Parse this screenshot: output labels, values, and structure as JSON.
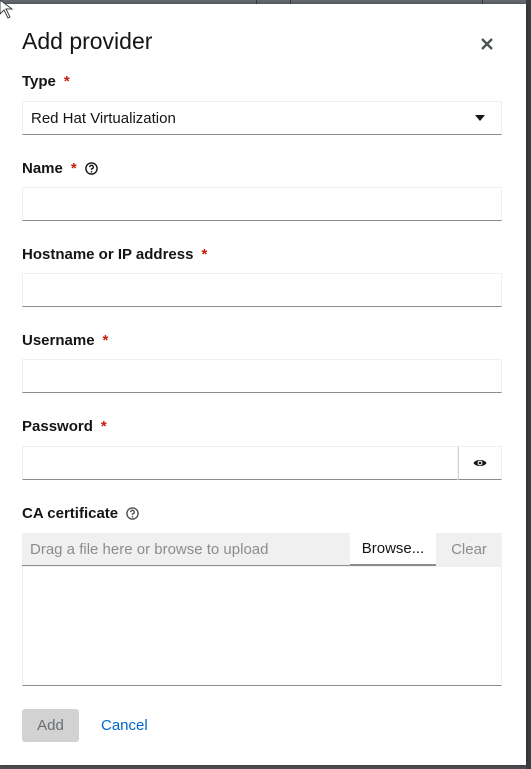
{
  "modal": {
    "title": "Add provider",
    "close_icon": "close-icon"
  },
  "form": {
    "required_marker": "*",
    "type": {
      "label": "Type",
      "selected": "Red Hat Virtualization",
      "toggle_icon": "caret-down-icon"
    },
    "name": {
      "label": "Name",
      "value": "",
      "help_icon": "question-circle-icon"
    },
    "hostname": {
      "label": "Hostname or IP address",
      "value": ""
    },
    "username": {
      "label": "Username",
      "value": ""
    },
    "password": {
      "label": "Password",
      "value": "",
      "toggle_icon": "eye-icon"
    },
    "ca_certificate": {
      "label": "CA certificate",
      "help_icon": "question-circle-icon",
      "filename_placeholder": "Drag a file here or browse to upload",
      "browse_label": "Browse...",
      "clear_label": "Clear",
      "content": ""
    }
  },
  "actions": {
    "add_label": "Add",
    "cancel_label": "Cancel"
  },
  "colors": {
    "required": "#c9190b",
    "link": "#0066cc",
    "disabled_button": "#d2d2d2",
    "backdrop": "#4f5255"
  }
}
